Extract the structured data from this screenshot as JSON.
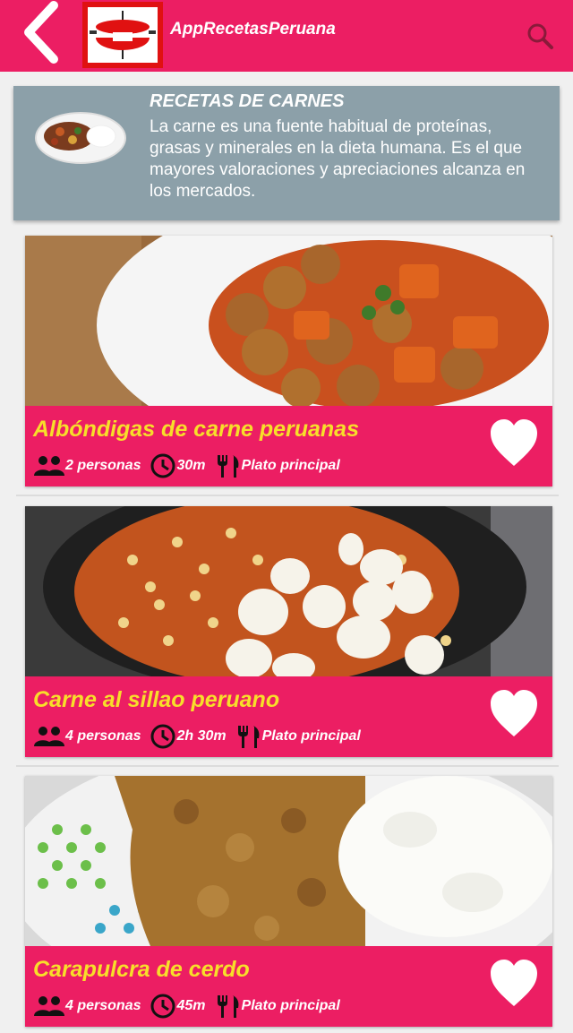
{
  "appbar": {
    "title": "AppRecetasPeruana",
    "color": "#ec1e63",
    "icons": [
      "back-arrow-icon",
      "pot-logo-icon",
      "search-icon"
    ]
  },
  "banner": {
    "title": "RECETAS DE CARNES",
    "description": "La carne es una fuente habitual de proteínas, grasas y minerales en la dieta humana. Es el que mayores valoraciones y apreciaciones alcanza en los mercados.",
    "color": "#8ca0a9"
  },
  "recipes": [
    {
      "title": "Albóndigas de carne peruanas",
      "servings": "2 personas",
      "time": "30m",
      "category": "Plato principal"
    },
    {
      "title": "Carne al sillao peruano",
      "servings": "4 personas",
      "time": "2h 30m",
      "category": "Plato principal"
    },
    {
      "title": "Carapulcra de cerdo",
      "servings": "4 personas",
      "time": "45m",
      "category": "Plato principal"
    }
  ],
  "colors": {
    "title_yellow": "#f7df2a",
    "card_pink": "#ec1e63"
  }
}
